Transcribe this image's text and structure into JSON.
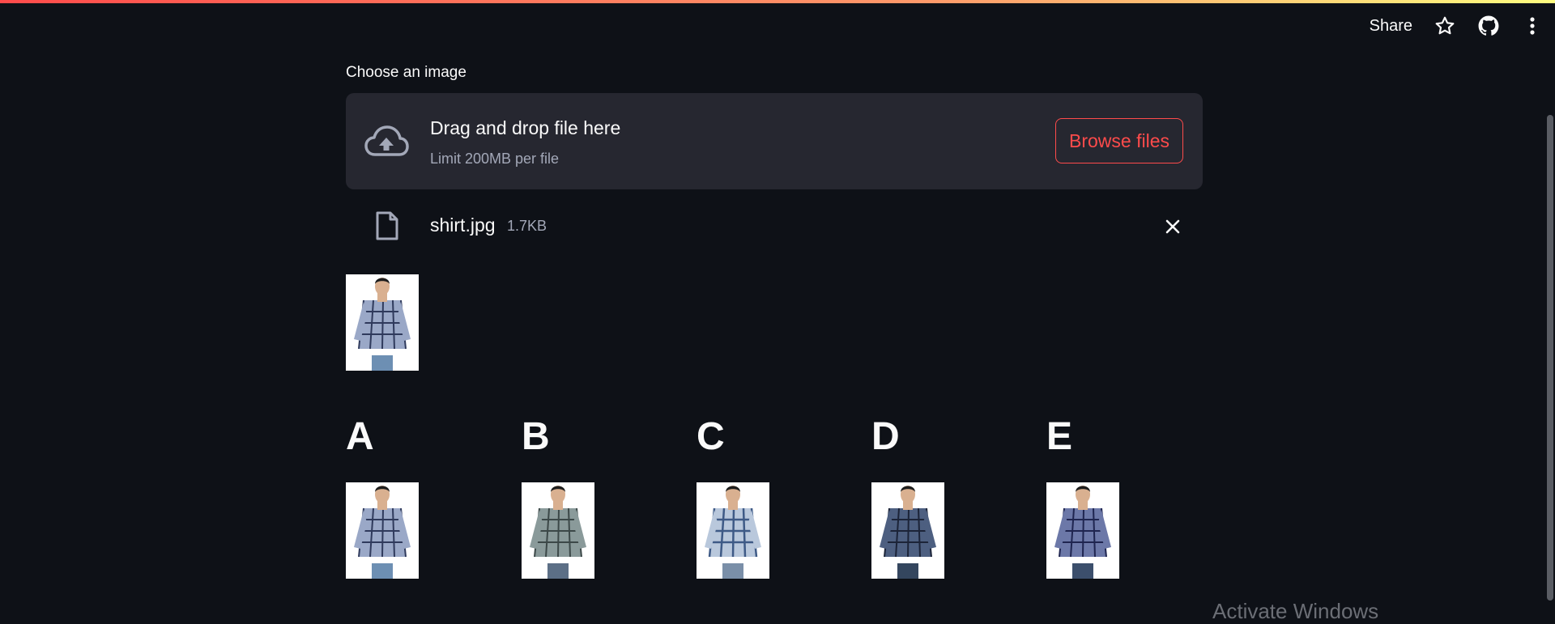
{
  "toolbar": {
    "share_label": "Share",
    "star_icon": "star-icon",
    "github_icon": "github-icon",
    "menu_icon": "more-vertical-icon"
  },
  "uploader": {
    "label": "Choose an image",
    "drop_title": "Drag and drop file here",
    "limit_text": "Limit 200MB per file",
    "browse_label": "Browse files",
    "accent_color": "#ff4b4b"
  },
  "uploaded_file": {
    "name": "shirt.jpg",
    "size": "1.7KB"
  },
  "results": {
    "labels": [
      "A",
      "B",
      "C",
      "D",
      "E"
    ]
  },
  "watermark": "Activate Windows"
}
